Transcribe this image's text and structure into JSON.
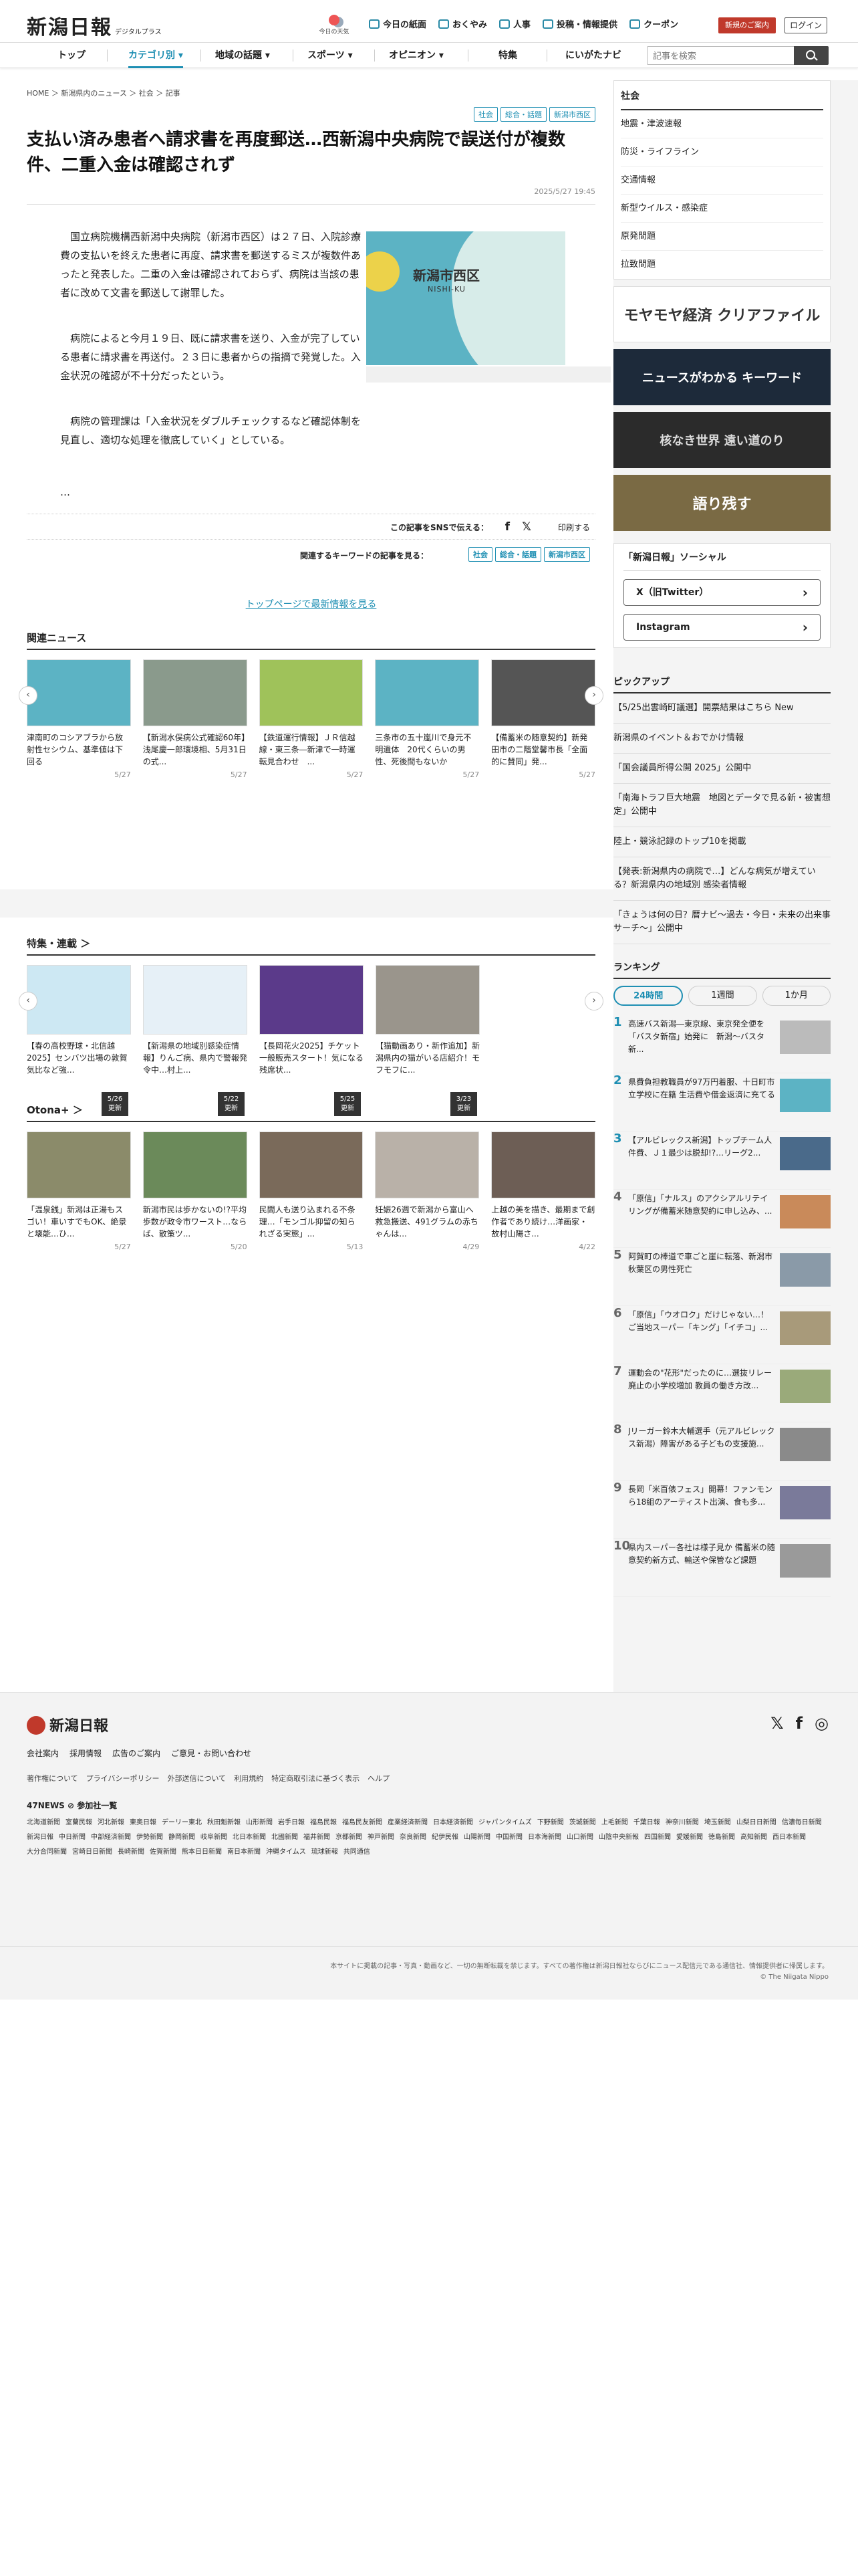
{
  "header": {
    "logo": "新潟日報",
    "logo_sub": "デジタルプラス",
    "weather_label": "今日の天気",
    "links": [
      "今日の紙面",
      "おくやみ",
      "人事",
      "投稿・情報提供",
      "クーポン"
    ],
    "campaign": "新規のご案内",
    "login": "ログイン"
  },
  "nav": {
    "items": [
      "トップ",
      "カテゴリ別 ▾",
      "地域の話題 ▾",
      "スポーツ ▾",
      "オピニオン ▾",
      "特集",
      "にいがたナビ"
    ],
    "search_placeholder": "記事を検索"
  },
  "breadcrumb": "HOME ＞ 新潟県内のニュース ＞ 社会 ＞ 記事",
  "article": {
    "tags": [
      "社会",
      "総合・話題",
      "新潟市西区"
    ],
    "headline": "支払い済み患者へ請求書を再度郵送…西新潟中央病院で誤送付が複数件、二重入金は確認されず",
    "date": "2025/5/27 19:45",
    "paragraphs": [
      "国立病院機構西新潟中央病院（新潟市西区）は２７日、入院診療費の支払いを終えた患者に再度、請求書を郵送するミスが複数件あったと発表した。二重の入金は確認されておらず、病院は当該の患者に改めて文書を郵送して謝罪した。",
      "病院によると今月１９日、既に請求書を送り、入金が完了している患者に請求書を再送付。２３日に患者からの指摘で発覚した。入金状況の確認が不十分だったという。",
      "病院の管理課は「入金状況をダブルチェックするなど確認体制を見直し、適切な処理を徹底していく」としている。",
      "…"
    ],
    "map_label": "新潟市西区",
    "map_en": "NISHI-KU",
    "sns_label": "この記事をSNSで伝える：",
    "print": "印刷する",
    "kw_label": "関連するキーワードの記事を見る：",
    "more": "トップページで最新情報を見る"
  },
  "related": {
    "title": "関連ニュース",
    "items": [
      {
        "t": "津南町のコシアブラから放射性セシウム、基準値は下回る",
        "d": "5/27"
      },
      {
        "t": "【新潟水俣病公式確認60年】浅尾慶一郎環境相、5月31日の式...",
        "d": "5/27"
      },
      {
        "t": "【鉄道運行情報】ＪＲ信越線・東三条―新津で一時運転見合わせ　...",
        "d": "5/27"
      },
      {
        "t": "三条市の五十嵐川で身元不明遺体　20代くらいの男性、死後間もないか",
        "d": "5/27"
      },
      {
        "t": "【備蓄米の随意契約】新発田市の二階堂馨市長「全面的に賛同」発...",
        "d": "5/27"
      }
    ]
  },
  "features": {
    "title": "特集・連載 ＞",
    "items": [
      {
        "t": "【春の高校野球・北信越2025】センバツ出場の敦賀気比など強...",
        "d": "5/26\n更新"
      },
      {
        "t": "【新潟県の地域別感染症情報】りんご病、県内で警報発令中…村上...",
        "d": "5/22\n更新"
      },
      {
        "t": "【長岡花火2025】チケット一般販売スタート！気になる残席状...",
        "d": "5/25\n更新"
      },
      {
        "t": "【猫動画あり・新作追加】新潟県内の猫がいる店紹介！モフモフに...",
        "d": "3/23\n更新"
      }
    ]
  },
  "otona": {
    "title": "Otona+ ＞",
    "items": [
      {
        "t": "「温泉銭」新潟は正湯もスゴい！車いすでもOK、絶景と壊能…ひ...",
        "d": "5/27"
      },
      {
        "t": "新潟市民は歩かないの!?平均歩数が政令市ワースト…ならば、散策ツ...",
        "d": "5/20"
      },
      {
        "t": "民間人も送り込まれる不条理…「モンゴル抑留の知られざる実態」...",
        "d": "5/13"
      },
      {
        "t": "妊娠26週で新潟から富山へ救急搬送、491グラムの赤ちゃんは...",
        "d": "4/29"
      },
      {
        "t": "上越の美を描き、最期まで創作者であり続け…洋画家・故村山陽さ...",
        "d": "4/22"
      }
    ]
  },
  "sidebar": {
    "cat_title": "社会",
    "cats": [
      "地震・津波速報",
      "防災・ライフライン",
      "交通情報",
      "新型ウイルス・感染症",
      "原発問題",
      "拉致問題"
    ],
    "banners": [
      "モヤモヤ経済 クリアファイル",
      "ニュースがわかる キーワード",
      "核なき世界 遠い道のり",
      "語り残す"
    ],
    "social_title": "「新潟日報」ソーシャル",
    "social": [
      "X（旧Twitter）",
      "Instagram"
    ],
    "pickup_title": "ピックアップ",
    "pickup": [
      "【5/25出雲崎町議選】開票結果はこちら New",
      "新潟県のイベント＆おでかけ情報",
      "「国会議員所得公開 2025」公開中",
      "「南海トラフ巨大地震　地図とデータで見る新・被害想定」公開中",
      "陸上・競泳記録のトップ10を掲載",
      "【発表:新潟県内の病院で…】どんな病気が増えている？新潟県内の地域別 感染者情報",
      "「きょうは何の日？暦ナビ～過去・今日・未来の出来事サーチ～」公開中"
    ],
    "rank_title": "ランキング",
    "rank_tabs": [
      "24時間",
      "1週間",
      "1か月"
    ],
    "ranking": [
      "高速バス新潟―東京線、東京発全便を「バスタ新宿」始発に　新潟～バスタ新...",
      "県費負担教職員が97万円着服、十日町市立学校に在籍 生活費や借金返済に充てる",
      "【アルビレックス新潟】トップチーム人件費、Ｊ１最少は脱却!?…リーグ2...",
      "「原信」「ナルス」のアクシアルリテイリングが備蓄米随意契約に申し込み、...",
      "阿賀町の棒道で車ごと崖に転落、新潟市秋葉区の男性死亡",
      "「原信」「ウオロク」だけじゃない…！ご当地スーパー「キング」「イチコ」...",
      "運動会の\"花形\"だったのに…選抜リレー廃止の小学校増加 教員の働き方改...",
      "Jリーガー鈴木大輔選手（元アルビレックス新潟）障害がある子どもの支援施...",
      "長岡「米百俵フェス」開幕！ファンモンら18組のアーティスト出演、食も多...",
      "県内スーパー各社は様子見か 備蓄米の随意契約新方式、輸送や保管など課題"
    ]
  },
  "footer": {
    "logo": "新潟日報",
    "links1": [
      "会社案内",
      "採用情報",
      "広告のご案内",
      "ご意見・お問い合わせ"
    ],
    "links2": [
      "著作権について",
      "プライバシーポリシー",
      "外部送信について",
      "利用規約",
      "特定商取引法に基づく表示",
      "ヘルプ"
    ],
    "p47": "47NEWS ⊘ 参加社一覧",
    "papers": [
      "北海道新聞",
      "室蘭民報",
      "河北新報",
      "東奥日報",
      "デーリー東北",
      "秋田魁新報",
      "山形新聞",
      "岩手日報",
      "福島民報",
      "福島民友新聞",
      "産業経済新聞",
      "日本経済新聞",
      "ジャパンタイムズ",
      "下野新聞",
      "茨城新聞",
      "上毛新聞",
      "千葉日報",
      "神奈川新聞",
      "埼玉新聞",
      "山梨日日新聞",
      "信濃毎日新聞",
      "新潟日報",
      "中日新聞",
      "中部経済新聞",
      "伊勢新聞",
      "静岡新聞",
      "岐阜新聞",
      "北日本新聞",
      "北國新聞",
      "福井新聞",
      "京都新聞",
      "神戸新聞",
      "奈良新聞",
      "紀伊民報",
      "山陽新聞",
      "中国新聞",
      "日本海新聞",
      "山口新聞",
      "山陰中央新報",
      "四国新聞",
      "愛媛新聞",
      "徳島新聞",
      "高知新聞",
      "西日本新聞",
      "大分合同新聞",
      "宮崎日日新聞",
      "長崎新聞",
      "佐賀新聞",
      "熊本日日新聞",
      "南日本新聞",
      "沖縄タイムス",
      "琉球新報",
      "共同通信"
    ],
    "copy1": "本サイトに掲載の記事・写真・動画など、一切の無断転載を禁じます。すべての著作権は新潟日報社ならびにニュース配信元である通信社、情報提供者に帰属します。",
    "copy2": "© The Niigata Nippo"
  }
}
